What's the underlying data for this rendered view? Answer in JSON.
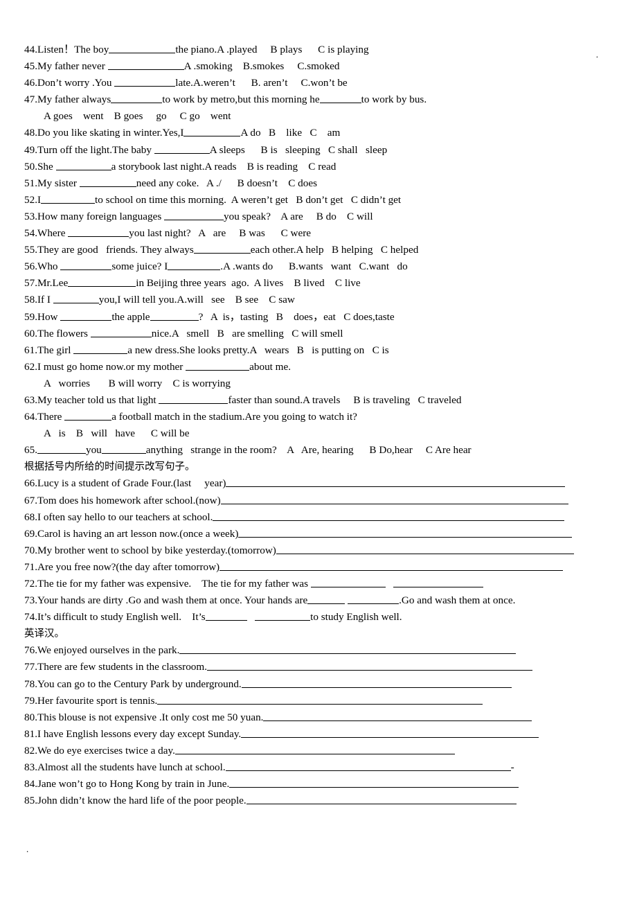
{
  "document": {
    "top_marker": ".",
    "bottom_marker": ".",
    "lines": [
      {
        "id": "q44",
        "indent": false,
        "segments": [
          {
            "t": "44.Listen！The boy"
          },
          {
            "u": 96
          },
          {
            "t": "the piano.A .played     B plays      C is playing"
          }
        ]
      },
      {
        "id": "q45",
        "indent": false,
        "segments": [
          {
            "t": "45.My father never "
          },
          {
            "u": 110
          },
          {
            "t": "A .smoking    B.smokes     C.smoked"
          }
        ]
      },
      {
        "id": "q46",
        "indent": false,
        "segments": [
          {
            "t": "46.Don’t worry .You "
          },
          {
            "u": 88
          },
          {
            "t": "late.A.weren’t      B. aren’t     C.won’t be"
          }
        ]
      },
      {
        "id": "q47",
        "indent": false,
        "segments": [
          {
            "t": "47.My father always"
          },
          {
            "u": 74
          },
          {
            "t": "to work by metro,but this morning he"
          },
          {
            "u": 60
          },
          {
            "t": "to work by bus."
          }
        ]
      },
      {
        "id": "q47opts",
        "indent": true,
        "segments": [
          {
            "t": "A goes    went    B goes     go     C go    went"
          }
        ]
      },
      {
        "id": "q48",
        "indent": false,
        "segments": [
          {
            "t": "48.Do you like skating in winter.Yes,I"
          },
          {
            "u": 82
          },
          {
            "t": "A do   B    like   C    am"
          }
        ]
      },
      {
        "id": "q49",
        "indent": false,
        "segments": [
          {
            "t": "49.Turn off the light.The baby "
          },
          {
            "u": 80
          },
          {
            "t": "A sleeps      B is   sleeping   C shall   sleep"
          }
        ]
      },
      {
        "id": "q50",
        "indent": false,
        "segments": [
          {
            "t": "50.She "
          },
          {
            "u": 80
          },
          {
            "t": "a storybook last night.A reads    B is reading    C read"
          }
        ]
      },
      {
        "id": "q51",
        "indent": false,
        "segments": [
          {
            "t": "51.My sister "
          },
          {
            "u": 82
          },
          {
            "t": "need any coke.   A ./      B doesn’t    C does"
          }
        ]
      },
      {
        "id": "q52",
        "indent": false,
        "segments": [
          {
            "t": "52.I"
          },
          {
            "u": 78
          },
          {
            "t": "to school on time this morning.  A weren’t get   B don’t get   C didn’t get"
          }
        ]
      },
      {
        "id": "q53",
        "indent": false,
        "segments": [
          {
            "t": "53.How many foreign languages "
          },
          {
            "u": 86
          },
          {
            "t": "you speak?    A are     B do    C will"
          }
        ]
      },
      {
        "id": "q54",
        "indent": false,
        "segments": [
          {
            "t": "54.Where "
          },
          {
            "u": 88
          },
          {
            "t": "you last night?   A   are     B was      C were"
          }
        ]
      },
      {
        "id": "q55",
        "indent": false,
        "segments": [
          {
            "t": "55.They are good   friends. They always"
          },
          {
            "u": 82
          },
          {
            "t": "each other.A help   B helping   C helped"
          }
        ]
      },
      {
        "id": "q56",
        "indent": false,
        "segments": [
          {
            "t": "56.Who "
          },
          {
            "u": 74
          },
          {
            "t": "some juice? I"
          },
          {
            "u": 76
          },
          {
            "t": ".A .wants do      B.wants   want   C.want   do"
          }
        ]
      },
      {
        "id": "q57",
        "indent": false,
        "segments": [
          {
            "t": "57.Mr.Lee"
          },
          {
            "u": 98
          },
          {
            "t": "in Beijing three years  ago.  A lives    B lived    C live"
          }
        ]
      },
      {
        "id": "q58",
        "indent": false,
        "segments": [
          {
            "t": "58.If I "
          },
          {
            "u": 66
          },
          {
            "t": "you,I will tell you.A.will   see    B see    C saw"
          }
        ]
      },
      {
        "id": "q59",
        "indent": false,
        "segments": [
          {
            "t": "59.How "
          },
          {
            "u": 74
          },
          {
            "t": "the apple"
          },
          {
            "u": 70
          },
          {
            "t": "?   A  is，tasting   B    does，eat   C does,taste"
          }
        ]
      },
      {
        "id": "q60",
        "indent": false,
        "segments": [
          {
            "t": "60.The flowers "
          },
          {
            "u": 88
          },
          {
            "t": "nice.A   smell   B   are smelling   C will smell"
          }
        ]
      },
      {
        "id": "q61",
        "indent": false,
        "segments": [
          {
            "t": "61.The girl "
          },
          {
            "u": 78
          },
          {
            "t": "a new dress.She looks pretty.A   wears   B   is putting on   C is"
          }
        ]
      },
      {
        "id": "q62",
        "indent": false,
        "segments": [
          {
            "t": "62.I must go home now.or my mother "
          },
          {
            "u": 92
          },
          {
            "t": "about me."
          }
        ]
      },
      {
        "id": "q62opts",
        "indent": true,
        "segments": [
          {
            "t": "A   worries       B will worry    C is worrying"
          }
        ]
      },
      {
        "id": "q63",
        "indent": false,
        "segments": [
          {
            "t": "63.My teacher told us that light "
          },
          {
            "u": 100
          },
          {
            "t": "faster than sound.A travels     B is traveling   C traveled"
          }
        ]
      },
      {
        "id": "q64",
        "indent": false,
        "segments": [
          {
            "t": "64.There "
          },
          {
            "u": 68
          },
          {
            "t": "a football match in the stadium.Are you going to watch it?"
          }
        ]
      },
      {
        "id": "q64opts",
        "indent": true,
        "segments": [
          {
            "t": "A   is    B   will   have      C will be"
          }
        ]
      },
      {
        "id": "q65",
        "indent": false,
        "segments": [
          {
            "t": "65."
          },
          {
            "u": 70
          },
          {
            "t": "you"
          },
          {
            "u": 64
          },
          {
            "t": "anything   strange in the room?    A   Are, hearing      B Do,hear     C Are hear"
          }
        ]
      },
      {
        "id": "heading1",
        "indent": false,
        "cn": true,
        "segments": [
          {
            "t": "根据括号内所给的时间提示改写句子。"
          }
        ]
      },
      {
        "id": "q66",
        "indent": false,
        "segments": [
          {
            "t": "66.Lucy is a student of Grade Four.(last     year)"
          },
          {
            "u": 490
          }
        ]
      },
      {
        "id": "q67",
        "indent": false,
        "segments": [
          {
            "t": "67.Tom does his homework after school.(now)"
          },
          {
            "u": 502
          }
        ]
      },
      {
        "id": "q68",
        "indent": false,
        "segments": [
          {
            "t": "68.I often say hello to our teachers at school."
          },
          {
            "u": 508
          }
        ]
      },
      {
        "id": "q69",
        "indent": false,
        "segments": [
          {
            "t": "69.Carol is having an art lesson now.(once a week)"
          },
          {
            "u": 482
          }
        ]
      },
      {
        "id": "q70",
        "indent": false,
        "segments": [
          {
            "t": "70.My brother went to school by bike yesterday.(tomorrow)"
          },
          {
            "u": 430
          }
        ]
      },
      {
        "id": "q71",
        "indent": false,
        "segments": [
          {
            "t": "71.Are you free now?(the day after tomorrow)"
          },
          {
            "u": 496
          }
        ]
      },
      {
        "id": "q72",
        "indent": false,
        "segments": [
          {
            "t": "72.The tie for my father was expensive.    The tie for my father was "
          },
          {
            "u": 108
          },
          {
            "t": "   "
          },
          {
            "u": 130
          }
        ]
      },
      {
        "id": "q73",
        "indent": false,
        "segments": [
          {
            "t": "73.Your hands are dirty .Go and wash them at once. Your hands are"
          },
          {
            "u": 54
          },
          {
            "t": " "
          },
          {
            "u": 74
          },
          {
            "t": ".Go and wash them at once."
          }
        ]
      },
      {
        "id": "q74",
        "indent": false,
        "segments": [
          {
            "t": "74.It’s difficult to study English well.    It’s"
          },
          {
            "u": 60
          },
          {
            "t": "   "
          },
          {
            "u": 80
          },
          {
            "t": "to study English well."
          }
        ]
      },
      {
        "id": "heading2",
        "indent": false,
        "cn": true,
        "segments": [
          {
            "t": "英译汉。"
          }
        ]
      },
      {
        "id": "q76",
        "indent": false,
        "segments": [
          {
            "t": "76.We enjoyed ourselves in the park."
          },
          {
            "u": 486
          }
        ]
      },
      {
        "id": "q77",
        "indent": false,
        "segments": [
          {
            "t": "77.There are few students in the classroom."
          },
          {
            "u": 470
          }
        ]
      },
      {
        "id": "q78",
        "indent": false,
        "segments": [
          {
            "t": "78.You can go to the Century Park by underground."
          },
          {
            "u": 390
          }
        ]
      },
      {
        "id": "q79",
        "indent": false,
        "segments": [
          {
            "t": "79.Her favourite sport is tennis."
          },
          {
            "u": 470
          }
        ]
      },
      {
        "id": "q80",
        "indent": false,
        "segments": [
          {
            "t": "80.This blouse is not expensive .It only cost me 50 yuan."
          },
          {
            "u": 388
          }
        ]
      },
      {
        "id": "q81",
        "indent": false,
        "segments": [
          {
            "t": "81.I have English lessons every day except Sunday."
          },
          {
            "u": 430
          }
        ]
      },
      {
        "id": "q82",
        "indent": false,
        "segments": [
          {
            "t": "82.We do eye exercises twice a day."
          },
          {
            "u": 404
          }
        ]
      },
      {
        "id": "q83",
        "indent": false,
        "segments": [
          {
            "t": "83.Almost all the students have lunch at school."
          },
          {
            "u": 412
          },
          {
            "t": "-"
          }
        ]
      },
      {
        "id": "q84",
        "indent": false,
        "segments": [
          {
            "t": "84.Jane won’t go to Hong Kong by train in June."
          },
          {
            "u": 418
          }
        ]
      },
      {
        "id": "q85",
        "indent": false,
        "segments": [
          {
            "t": "85.John didn’t know the hard life of the poor people."
          },
          {
            "u": 390
          }
        ]
      }
    ]
  }
}
